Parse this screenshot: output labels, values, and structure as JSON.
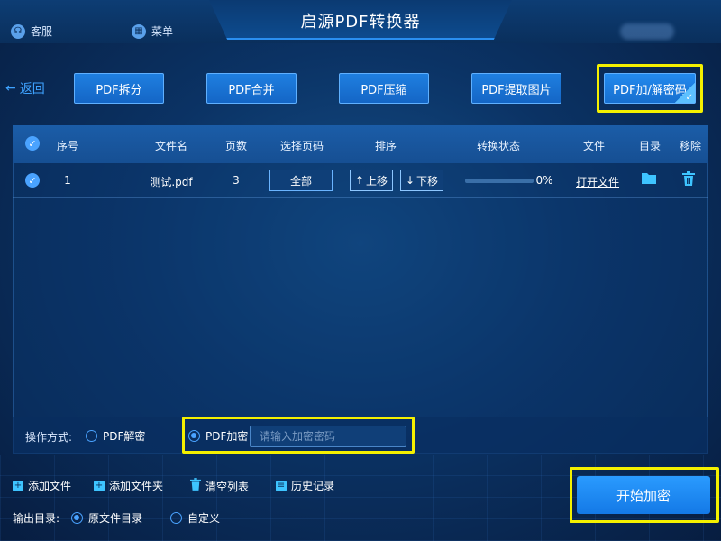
{
  "window": {
    "title": "启源PDF转换器",
    "service_label": "客服",
    "menu_label": "菜单"
  },
  "nav": {
    "back_label": "返回",
    "tools": [
      "PDF拆分",
      "PDF合并",
      "PDF压缩",
      "PDF提取图片",
      "PDF加/解密码"
    ],
    "active_tool": "PDF加/解密码"
  },
  "table": {
    "headers": {
      "index": "序号",
      "filename": "文件名",
      "pages": "页数",
      "select_pages": "选择页码",
      "order": "排序",
      "status": "转换状态",
      "file": "文件",
      "dir": "目录",
      "remove": "移除"
    },
    "rows": [
      {
        "index": "1",
        "filename": "测试.pdf",
        "pages": "3",
        "page_select": "全部",
        "move_up": "上移",
        "move_down": "下移",
        "progress_percent": 0,
        "progress_text": "0%",
        "open_file": "打开文件"
      }
    ]
  },
  "operation": {
    "label": "操作方式:",
    "decrypt_label": "PDF解密",
    "encrypt_label": "PDF加密",
    "selected": "PDF加密",
    "password_placeholder": "请输入加密密码"
  },
  "actions": {
    "add_file": "添加文件",
    "add_folder": "添加文件夹",
    "clear_list": "清空列表",
    "history": "历史记录"
  },
  "output": {
    "label": "输出目录:",
    "original_dir": "原文件目录",
    "custom": "自定义",
    "selected": "原文件目录"
  },
  "start_button": "开始加密",
  "colors": {
    "accent": "#1f7fe0",
    "highlight": "#f4f000",
    "icon_cyan": "#3ec4ff"
  }
}
